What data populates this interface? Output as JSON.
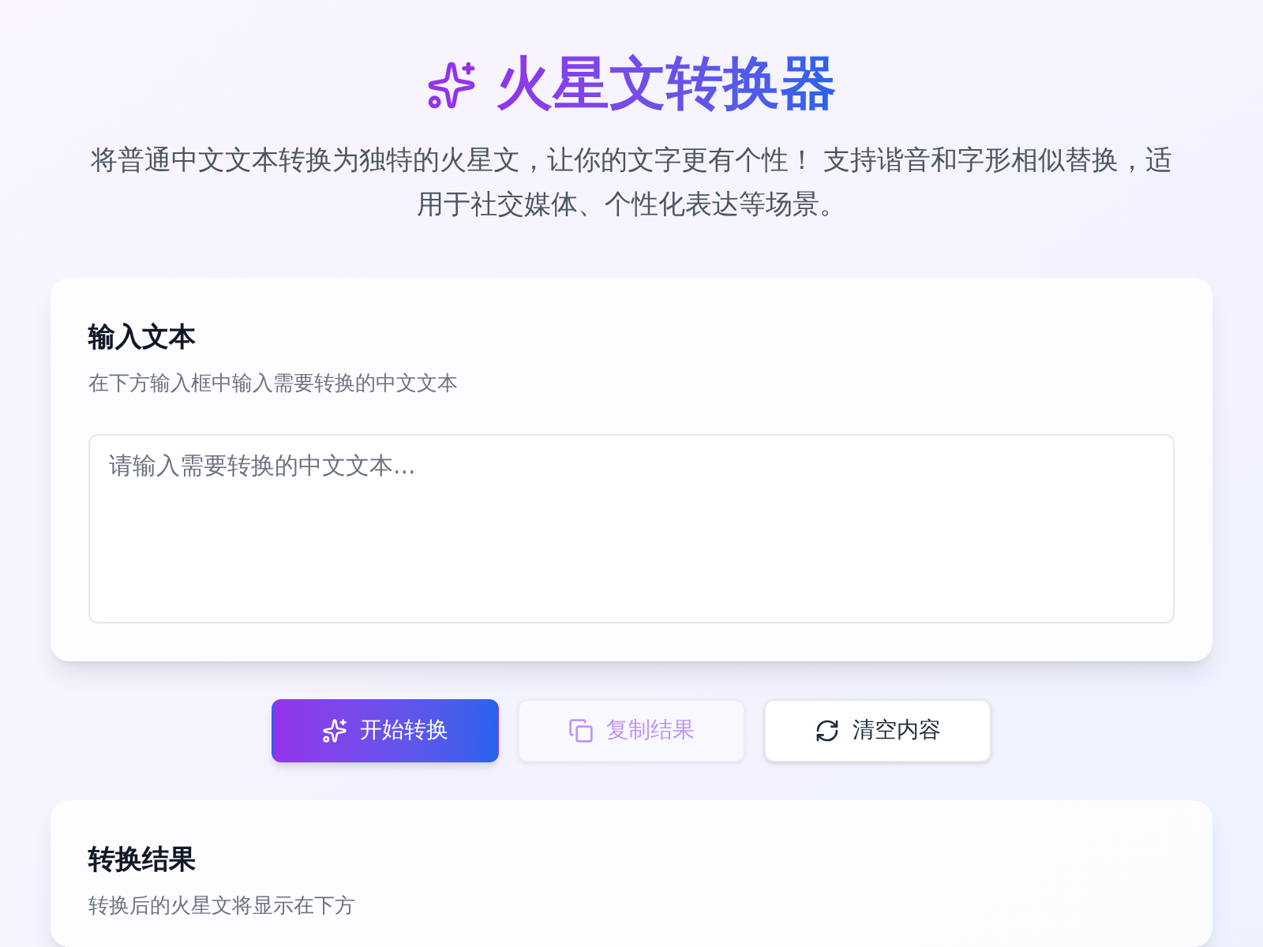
{
  "header": {
    "title": "火星文转换器",
    "description": "将普通中文文本转换为独特的火星文，让你的文字更有个性！ 支持谐音和字形相似替换，适用于社交媒体、个性化表达等场景。"
  },
  "input_card": {
    "title": "输入文本",
    "subtitle": "在下方输入框中输入需要转换的中文文本",
    "placeholder": "请输入需要转换的中文文本..."
  },
  "buttons": [
    {
      "kind": "convert",
      "label": "开始转换",
      "disabled": false
    },
    {
      "kind": "copy",
      "label": "复制结果",
      "disabled": true
    },
    {
      "kind": "clear",
      "label": "清空内容",
      "disabled": false
    }
  ],
  "result_card": {
    "title": "转换结果",
    "subtitle": "转换后的火星文将显示在下方"
  }
}
